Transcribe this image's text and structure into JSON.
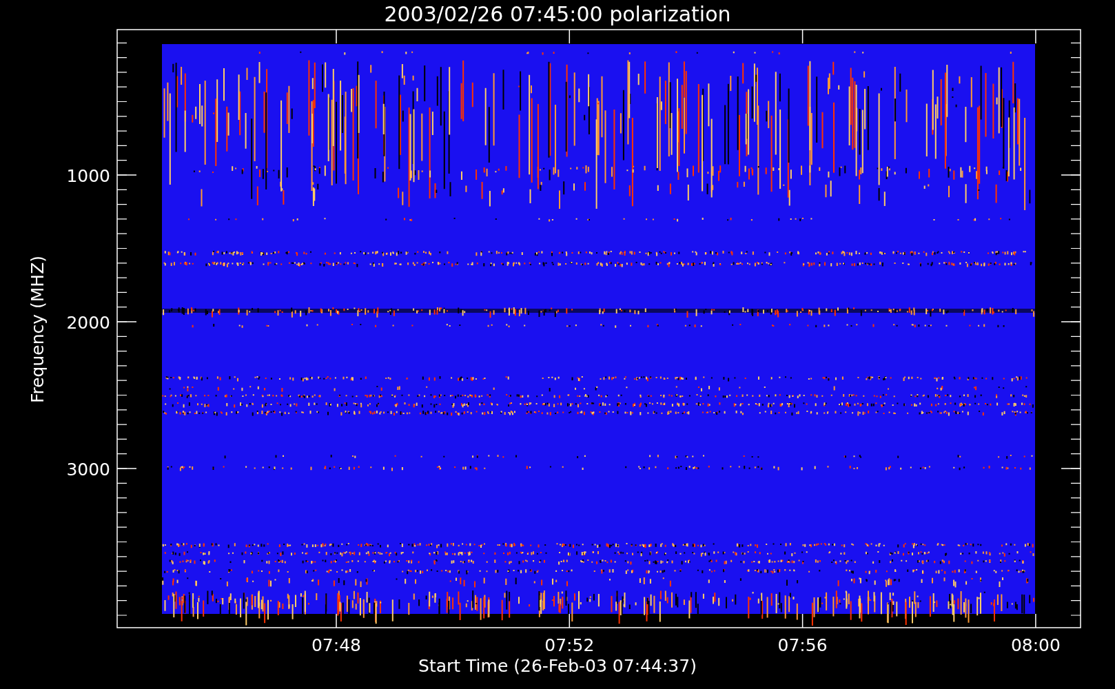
{
  "title": "2003/02/26 07:45:00 polarization",
  "ylabel": "Frequency (MHZ)",
  "xlabel": "Start Time (26-Feb-03 07:44:37)",
  "yticks": [
    "1000",
    "2000",
    "3000"
  ],
  "xticks": [
    "07:48",
    "07:52",
    "07:56",
    "08:00"
  ]
}
